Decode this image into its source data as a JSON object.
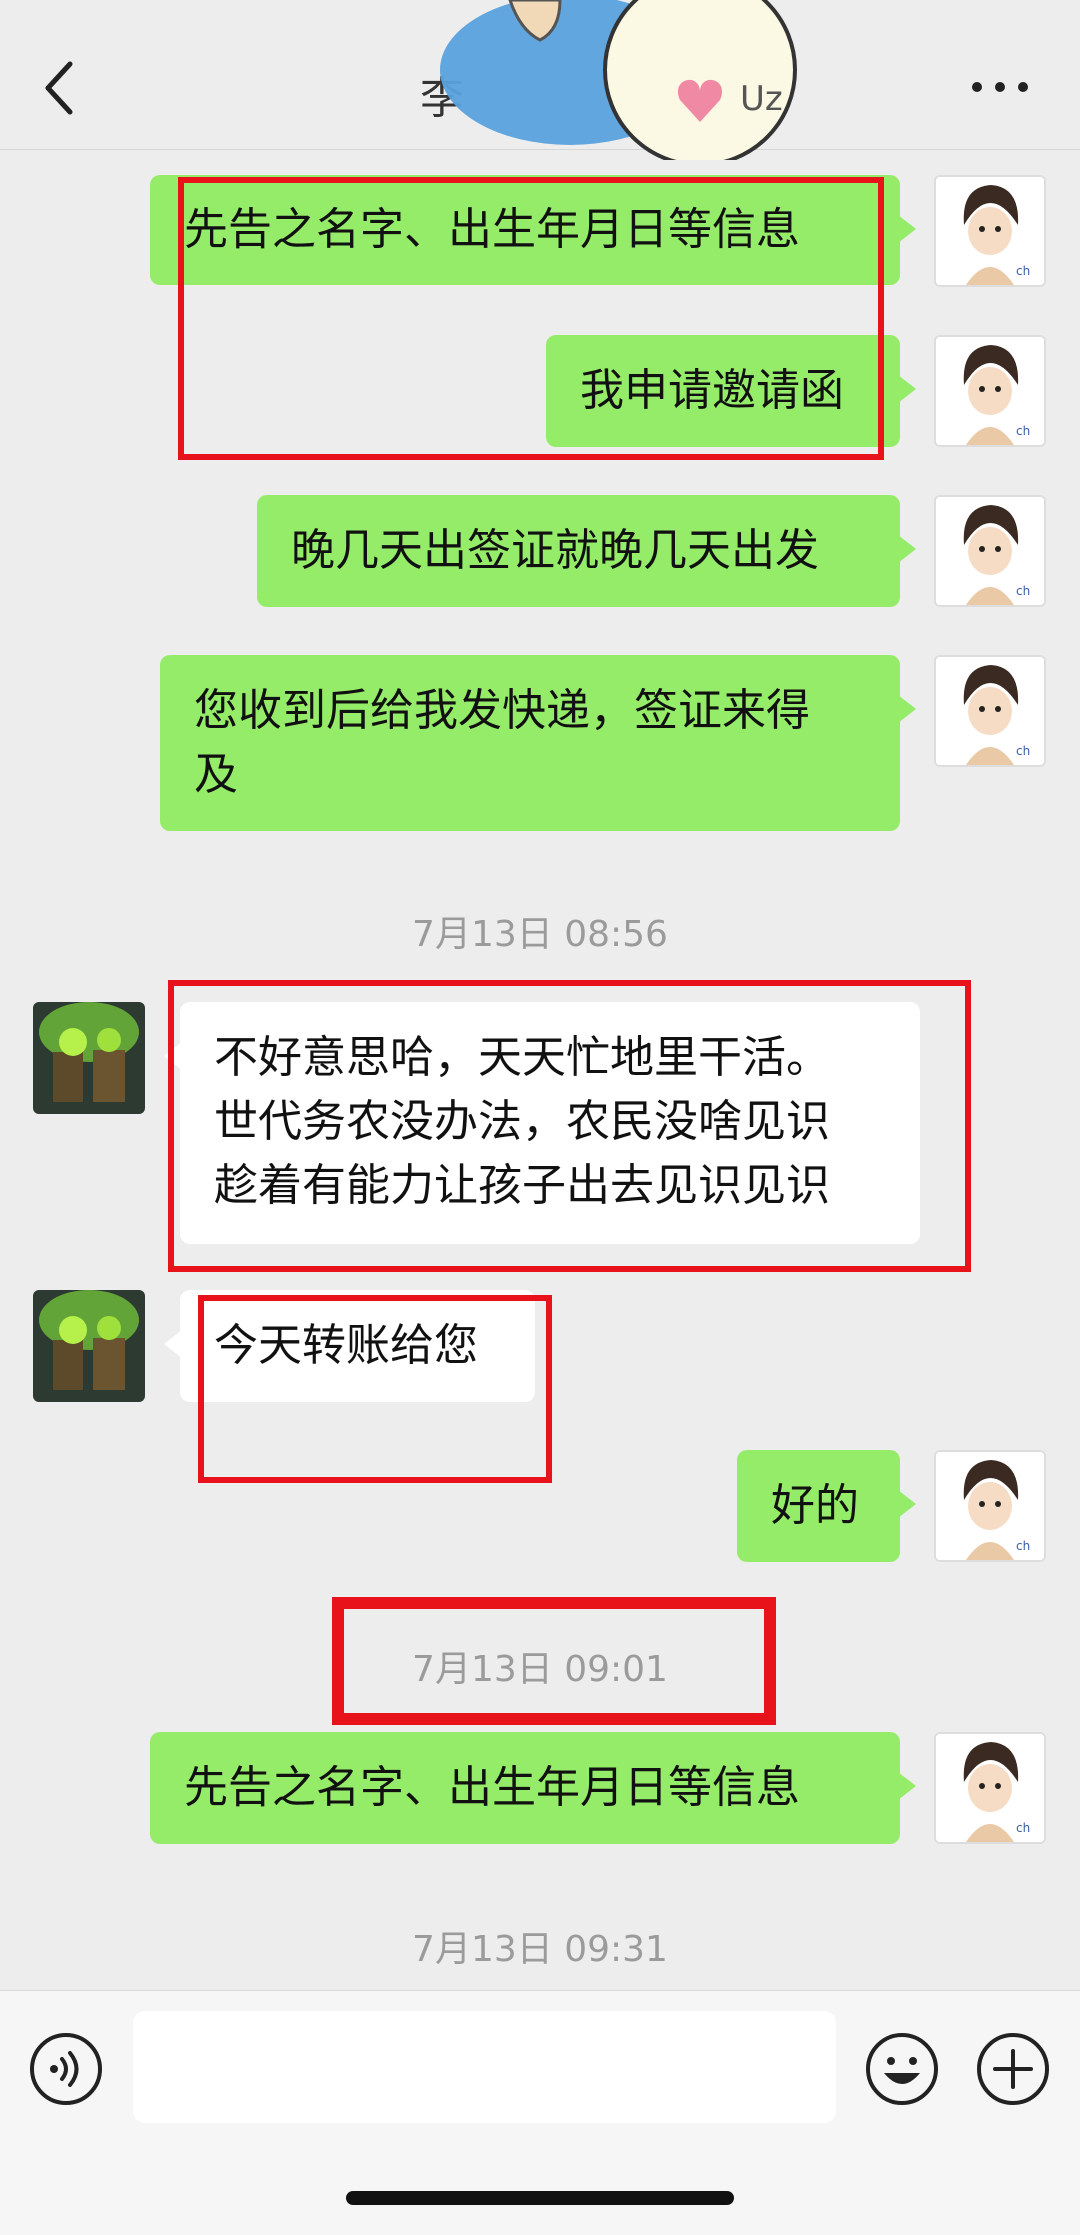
{
  "header": {
    "title": "李",
    "back_icon": "chevron-left-icon",
    "more_icon": "ellipsis-icon"
  },
  "messages": [
    {
      "side": "out",
      "text": "先告之名字、出生年月日等信息"
    },
    {
      "side": "out",
      "text": "我申请邀请函"
    },
    {
      "side": "out",
      "text": "晚几天出签证就晚几天出发"
    },
    {
      "side": "out",
      "text_line1": "您收到后给我发快递，签证来得",
      "text_line2": "及"
    },
    {
      "timestamp": "7月13日 08:56"
    },
    {
      "side": "in",
      "text_line1": "不好意思哈，天天忙地里干活。",
      "text_line2": "世代务农没办法，农民没啥见识",
      "text_line3": "趁着有能力让孩子出去见识见识"
    },
    {
      "side": "in",
      "text": "今天转账给您"
    },
    {
      "side": "out",
      "text": "好的"
    },
    {
      "timestamp": "7月13日 09:01"
    },
    {
      "side": "out",
      "text": "先告之名字、出生年月日等信息"
    },
    {
      "timestamp": "7月13日 09:31"
    }
  ],
  "input_bar": {
    "voice_icon": "voice-icon",
    "emoji_icon": "emoji-icon",
    "plus_icon": "plus-icon",
    "input_value": ""
  },
  "colors": {
    "outgoing_bubble": "#95ec69",
    "incoming_bubble": "#ffffff",
    "background": "#ededed",
    "annotation_red": "#e8121a"
  }
}
